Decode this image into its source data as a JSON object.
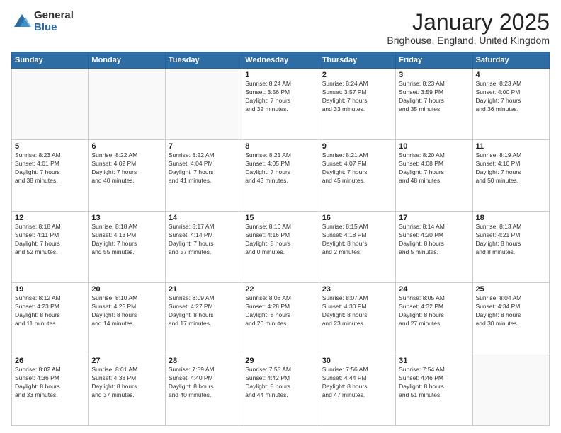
{
  "logo": {
    "general": "General",
    "blue": "Blue"
  },
  "title": "January 2025",
  "location": "Brighouse, England, United Kingdom",
  "days_of_week": [
    "Sunday",
    "Monday",
    "Tuesday",
    "Wednesday",
    "Thursday",
    "Friday",
    "Saturday"
  ],
  "weeks": [
    [
      {
        "day": "",
        "info": ""
      },
      {
        "day": "",
        "info": ""
      },
      {
        "day": "",
        "info": ""
      },
      {
        "day": "1",
        "info": "Sunrise: 8:24 AM\nSunset: 3:56 PM\nDaylight: 7 hours\nand 32 minutes."
      },
      {
        "day": "2",
        "info": "Sunrise: 8:24 AM\nSunset: 3:57 PM\nDaylight: 7 hours\nand 33 minutes."
      },
      {
        "day": "3",
        "info": "Sunrise: 8:23 AM\nSunset: 3:59 PM\nDaylight: 7 hours\nand 35 minutes."
      },
      {
        "day": "4",
        "info": "Sunrise: 8:23 AM\nSunset: 4:00 PM\nDaylight: 7 hours\nand 36 minutes."
      }
    ],
    [
      {
        "day": "5",
        "info": "Sunrise: 8:23 AM\nSunset: 4:01 PM\nDaylight: 7 hours\nand 38 minutes."
      },
      {
        "day": "6",
        "info": "Sunrise: 8:22 AM\nSunset: 4:02 PM\nDaylight: 7 hours\nand 40 minutes."
      },
      {
        "day": "7",
        "info": "Sunrise: 8:22 AM\nSunset: 4:04 PM\nDaylight: 7 hours\nand 41 minutes."
      },
      {
        "day": "8",
        "info": "Sunrise: 8:21 AM\nSunset: 4:05 PM\nDaylight: 7 hours\nand 43 minutes."
      },
      {
        "day": "9",
        "info": "Sunrise: 8:21 AM\nSunset: 4:07 PM\nDaylight: 7 hours\nand 45 minutes."
      },
      {
        "day": "10",
        "info": "Sunrise: 8:20 AM\nSunset: 4:08 PM\nDaylight: 7 hours\nand 48 minutes."
      },
      {
        "day": "11",
        "info": "Sunrise: 8:19 AM\nSunset: 4:10 PM\nDaylight: 7 hours\nand 50 minutes."
      }
    ],
    [
      {
        "day": "12",
        "info": "Sunrise: 8:18 AM\nSunset: 4:11 PM\nDaylight: 7 hours\nand 52 minutes."
      },
      {
        "day": "13",
        "info": "Sunrise: 8:18 AM\nSunset: 4:13 PM\nDaylight: 7 hours\nand 55 minutes."
      },
      {
        "day": "14",
        "info": "Sunrise: 8:17 AM\nSunset: 4:14 PM\nDaylight: 7 hours\nand 57 minutes."
      },
      {
        "day": "15",
        "info": "Sunrise: 8:16 AM\nSunset: 4:16 PM\nDaylight: 8 hours\nand 0 minutes."
      },
      {
        "day": "16",
        "info": "Sunrise: 8:15 AM\nSunset: 4:18 PM\nDaylight: 8 hours\nand 2 minutes."
      },
      {
        "day": "17",
        "info": "Sunrise: 8:14 AM\nSunset: 4:20 PM\nDaylight: 8 hours\nand 5 minutes."
      },
      {
        "day": "18",
        "info": "Sunrise: 8:13 AM\nSunset: 4:21 PM\nDaylight: 8 hours\nand 8 minutes."
      }
    ],
    [
      {
        "day": "19",
        "info": "Sunrise: 8:12 AM\nSunset: 4:23 PM\nDaylight: 8 hours\nand 11 minutes."
      },
      {
        "day": "20",
        "info": "Sunrise: 8:10 AM\nSunset: 4:25 PM\nDaylight: 8 hours\nand 14 minutes."
      },
      {
        "day": "21",
        "info": "Sunrise: 8:09 AM\nSunset: 4:27 PM\nDaylight: 8 hours\nand 17 minutes."
      },
      {
        "day": "22",
        "info": "Sunrise: 8:08 AM\nSunset: 4:28 PM\nDaylight: 8 hours\nand 20 minutes."
      },
      {
        "day": "23",
        "info": "Sunrise: 8:07 AM\nSunset: 4:30 PM\nDaylight: 8 hours\nand 23 minutes."
      },
      {
        "day": "24",
        "info": "Sunrise: 8:05 AM\nSunset: 4:32 PM\nDaylight: 8 hours\nand 27 minutes."
      },
      {
        "day": "25",
        "info": "Sunrise: 8:04 AM\nSunset: 4:34 PM\nDaylight: 8 hours\nand 30 minutes."
      }
    ],
    [
      {
        "day": "26",
        "info": "Sunrise: 8:02 AM\nSunset: 4:36 PM\nDaylight: 8 hours\nand 33 minutes."
      },
      {
        "day": "27",
        "info": "Sunrise: 8:01 AM\nSunset: 4:38 PM\nDaylight: 8 hours\nand 37 minutes."
      },
      {
        "day": "28",
        "info": "Sunrise: 7:59 AM\nSunset: 4:40 PM\nDaylight: 8 hours\nand 40 minutes."
      },
      {
        "day": "29",
        "info": "Sunrise: 7:58 AM\nSunset: 4:42 PM\nDaylight: 8 hours\nand 44 minutes."
      },
      {
        "day": "30",
        "info": "Sunrise: 7:56 AM\nSunset: 4:44 PM\nDaylight: 8 hours\nand 47 minutes."
      },
      {
        "day": "31",
        "info": "Sunrise: 7:54 AM\nSunset: 4:46 PM\nDaylight: 8 hours\nand 51 minutes."
      },
      {
        "day": "",
        "info": ""
      }
    ]
  ]
}
